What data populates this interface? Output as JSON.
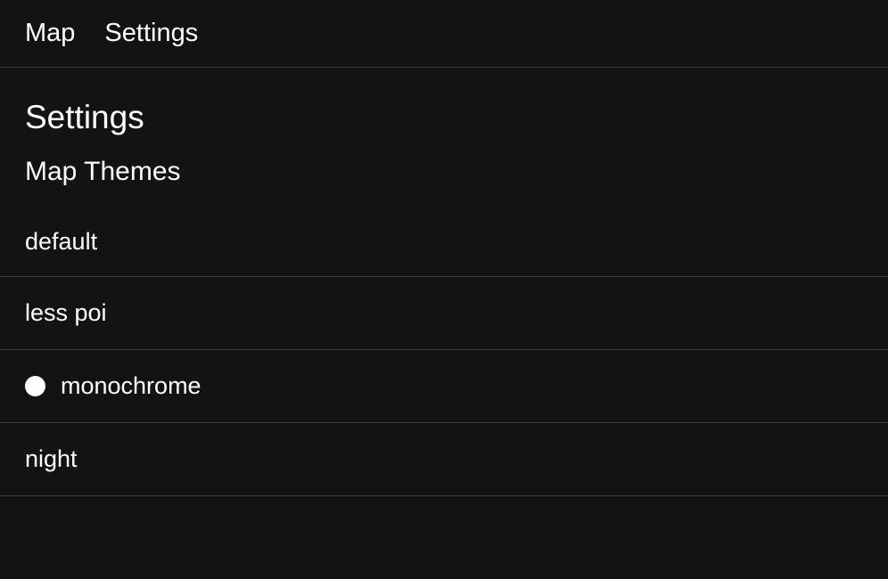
{
  "nav": {
    "items": [
      {
        "label": "Map"
      },
      {
        "label": "Settings"
      }
    ]
  },
  "page": {
    "title": "Settings",
    "section_title": "Map Themes"
  },
  "themes": {
    "items": [
      {
        "label": "default",
        "selected": false
      },
      {
        "label": "less poi",
        "selected": false
      },
      {
        "label": "monochrome",
        "selected": true
      },
      {
        "label": "night",
        "selected": false
      }
    ]
  }
}
